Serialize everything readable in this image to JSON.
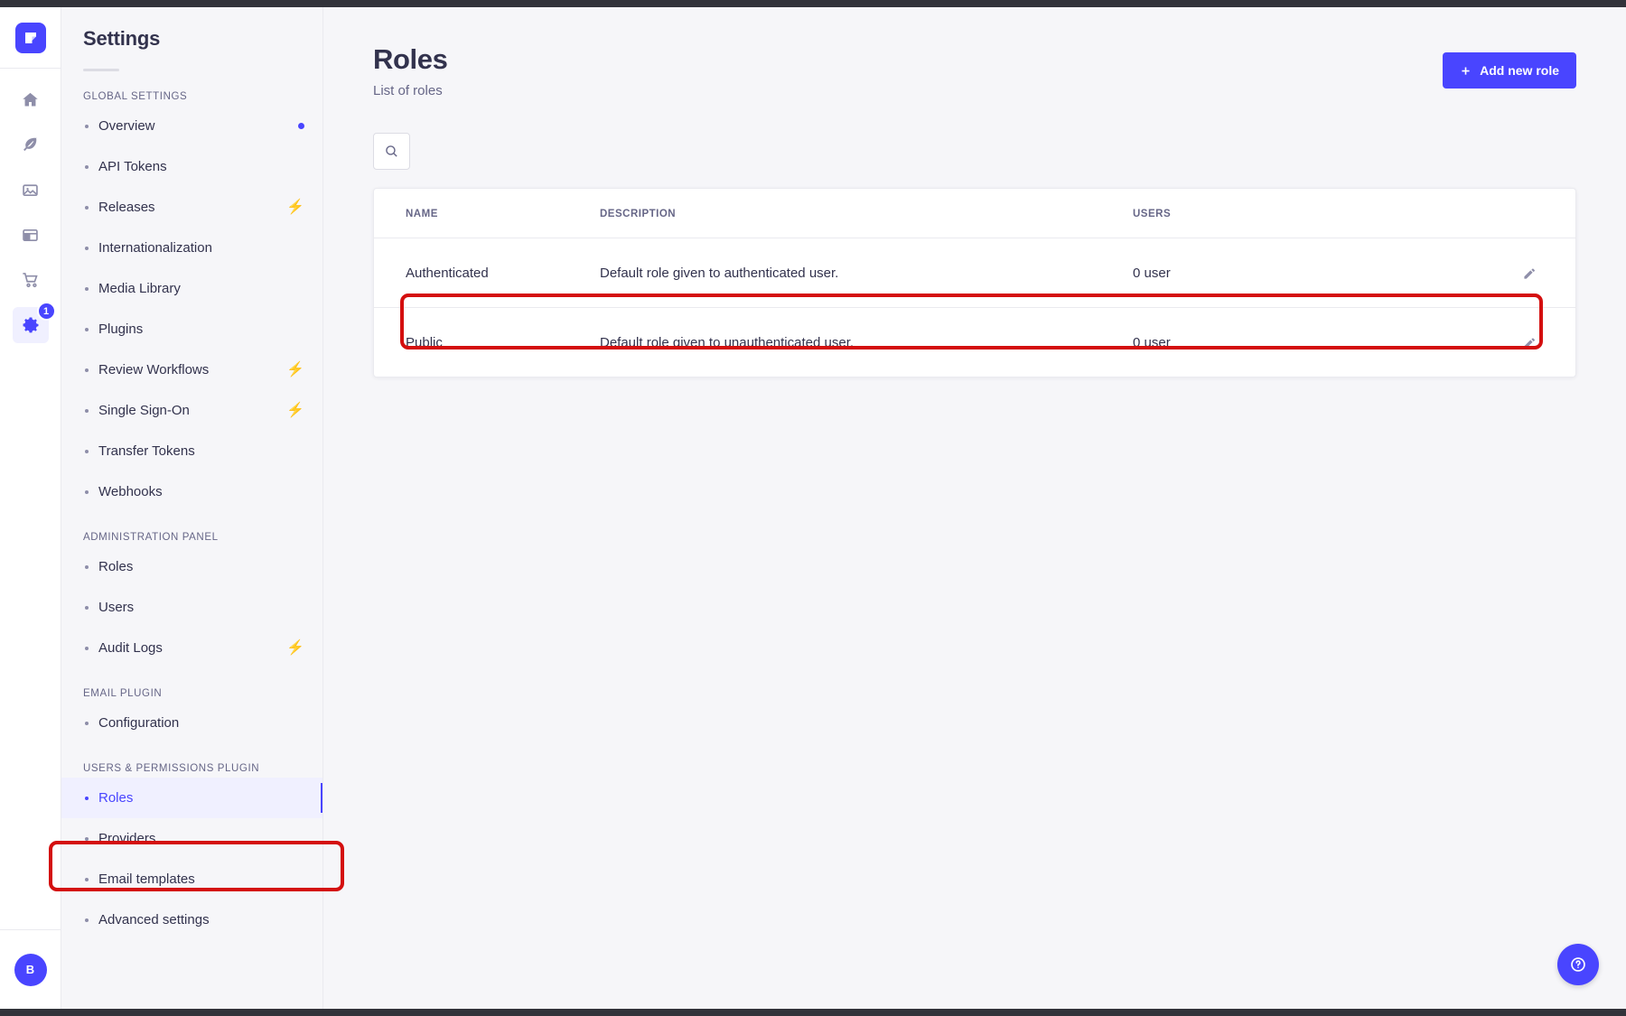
{
  "app": {
    "logo_icon": "strapi-logo-icon",
    "rail_items": [
      {
        "name": "home",
        "icon": "home-icon"
      },
      {
        "name": "content-manager",
        "icon": "feather-pen-icon"
      },
      {
        "name": "media-library",
        "icon": "image-icon"
      },
      {
        "name": "content-type-builder",
        "icon": "layout-icon"
      },
      {
        "name": "marketplace",
        "icon": "shopping-cart-icon"
      },
      {
        "name": "settings",
        "icon": "gear-icon",
        "active": true,
        "badge": "1"
      }
    ],
    "avatar_initial": "B"
  },
  "sidebar": {
    "title": "Settings",
    "sections": [
      {
        "label": "GLOBAL SETTINGS",
        "items": [
          {
            "label": "Overview",
            "indicator": "dot"
          },
          {
            "label": "API Tokens"
          },
          {
            "label": "Releases",
            "badge": "bolt"
          },
          {
            "label": "Internationalization"
          },
          {
            "label": "Media Library"
          },
          {
            "label": "Plugins"
          },
          {
            "label": "Review Workflows",
            "badge": "bolt"
          },
          {
            "label": "Single Sign-On",
            "badge": "bolt"
          },
          {
            "label": "Transfer Tokens"
          },
          {
            "label": "Webhooks"
          }
        ]
      },
      {
        "label": "ADMINISTRATION PANEL",
        "items": [
          {
            "label": "Roles"
          },
          {
            "label": "Users"
          },
          {
            "label": "Audit Logs",
            "badge": "bolt"
          }
        ]
      },
      {
        "label": "EMAIL PLUGIN",
        "items": [
          {
            "label": "Configuration"
          }
        ]
      },
      {
        "label": "USERS & PERMISSIONS PLUGIN",
        "items": [
          {
            "label": "Roles",
            "active": true
          },
          {
            "label": "Providers"
          },
          {
            "label": "Email templates"
          },
          {
            "label": "Advanced settings"
          }
        ]
      }
    ]
  },
  "page": {
    "title": "Roles",
    "subtitle": "List of roles",
    "add_button_label": "Add new role",
    "add_button_icon": "plus-icon",
    "search_icon": "search-icon",
    "help_icon": "question-mark-circle-icon"
  },
  "table": {
    "columns": [
      "NAME",
      "DESCRIPTION",
      "USERS",
      ""
    ],
    "rows": [
      {
        "name": "Authenticated",
        "description": "Default role given to authenticated user.",
        "users": "0 user",
        "action_icon": "pencil-edit-icon"
      },
      {
        "name": "Public",
        "description": "Default role given to unauthenticated user.",
        "users": "0 user",
        "action_icon": "pencil-edit-icon"
      }
    ]
  },
  "colors": {
    "accent": "#4945ff",
    "bolt": "#f29d41",
    "text": "#32324d",
    "muted": "#666687",
    "page_bg": "#f6f6f9",
    "annotation": "#d40f0f"
  }
}
